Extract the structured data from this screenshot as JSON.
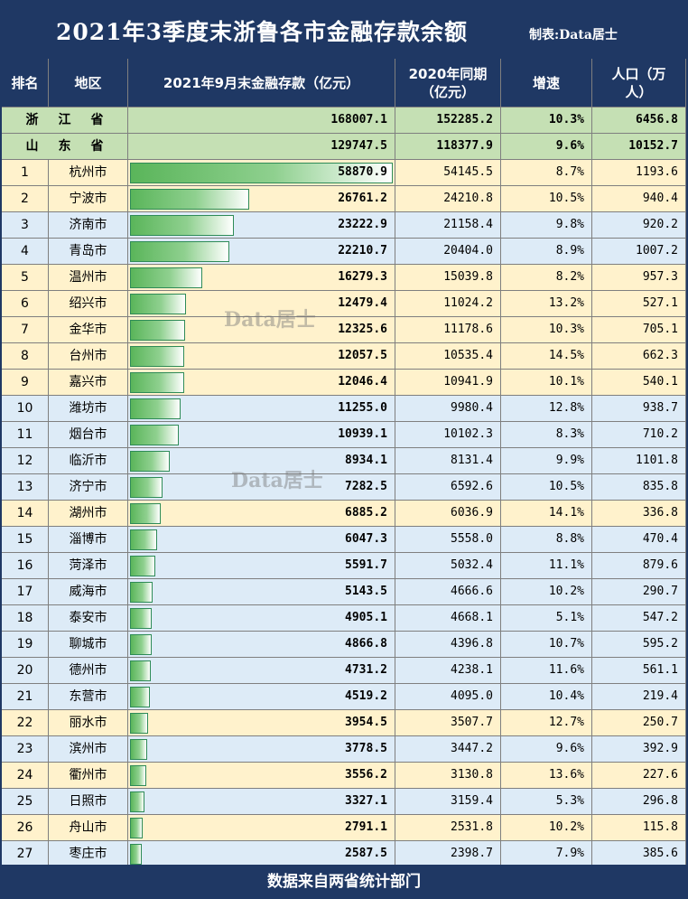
{
  "title": "2021年3季度末浙鲁各市金融存款余额",
  "credit": "制表:Data居士",
  "footer": "数据来自两省统计部门",
  "watermark": "Data居士",
  "headers": {
    "rank": "排名",
    "region": "地区",
    "deposit": "2021年9月末金融存款（亿元）",
    "prev_line1": "2020年同期",
    "prev_line2": "（亿元）",
    "growth": "增速",
    "pop_line1": "人口（万",
    "pop_line2": "人）"
  },
  "colors": {
    "header_bg": "#1f3864",
    "province_bg": "#c5e0b4",
    "zhejiang_bg": "#fff2cc",
    "shandong_bg": "#ddebf7",
    "bar": "#5ab55a"
  },
  "provinces": [
    {
      "name": "浙江省",
      "deposit": "168007.1",
      "prev": "152285.2",
      "growth": "10.3%",
      "pop": "6456.8"
    },
    {
      "name": "山东省",
      "deposit": "129747.5",
      "prev": "118377.9",
      "growth": "9.6%",
      "pop": "10152.7"
    }
  ],
  "chart_data": {
    "type": "table",
    "title": "2021年3季度末浙鲁各市金融存款余额",
    "columns": [
      "排名",
      "地区",
      "2021年9月末金融存款（亿元）",
      "2020年同期（亿元）",
      "增速",
      "人口（万人）"
    ],
    "bar_column": "2021年9月末金融存款（亿元）",
    "rows": [
      {
        "rank": "1",
        "city": "杭州市",
        "province": "zhejiang",
        "deposit": "58870.9",
        "prev": "54145.5",
        "growth": "8.7%",
        "pop": "1193.6"
      },
      {
        "rank": "2",
        "city": "宁波市",
        "province": "zhejiang",
        "deposit": "26761.2",
        "prev": "24210.8",
        "growth": "10.5%",
        "pop": "940.4"
      },
      {
        "rank": "3",
        "city": "济南市",
        "province": "shandong",
        "deposit": "23222.9",
        "prev": "21158.4",
        "growth": "9.8%",
        "pop": "920.2"
      },
      {
        "rank": "4",
        "city": "青岛市",
        "province": "shandong",
        "deposit": "22210.7",
        "prev": "20404.0",
        "growth": "8.9%",
        "pop": "1007.2"
      },
      {
        "rank": "5",
        "city": "温州市",
        "province": "zhejiang",
        "deposit": "16279.3",
        "prev": "15039.8",
        "growth": "8.2%",
        "pop": "957.3"
      },
      {
        "rank": "6",
        "city": "绍兴市",
        "province": "zhejiang",
        "deposit": "12479.4",
        "prev": "11024.2",
        "growth": "13.2%",
        "pop": "527.1"
      },
      {
        "rank": "7",
        "city": "金华市",
        "province": "zhejiang",
        "deposit": "12325.6",
        "prev": "11178.6",
        "growth": "10.3%",
        "pop": "705.1"
      },
      {
        "rank": "8",
        "city": "台州市",
        "province": "zhejiang",
        "deposit": "12057.5",
        "prev": "10535.4",
        "growth": "14.5%",
        "pop": "662.3"
      },
      {
        "rank": "9",
        "city": "嘉兴市",
        "province": "zhejiang",
        "deposit": "12046.4",
        "prev": "10941.9",
        "growth": "10.1%",
        "pop": "540.1"
      },
      {
        "rank": "10",
        "city": "潍坊市",
        "province": "shandong",
        "deposit": "11255.0",
        "prev": "9980.4",
        "growth": "12.8%",
        "pop": "938.7"
      },
      {
        "rank": "11",
        "city": "烟台市",
        "province": "shandong",
        "deposit": "10939.1",
        "prev": "10102.3",
        "growth": "8.3%",
        "pop": "710.2"
      },
      {
        "rank": "12",
        "city": "临沂市",
        "province": "shandong",
        "deposit": "8934.1",
        "prev": "8131.4",
        "growth": "9.9%",
        "pop": "1101.8"
      },
      {
        "rank": "13",
        "city": "济宁市",
        "province": "shandong",
        "deposit": "7282.5",
        "prev": "6592.6",
        "growth": "10.5%",
        "pop": "835.8"
      },
      {
        "rank": "14",
        "city": "湖州市",
        "province": "zhejiang",
        "deposit": "6885.2",
        "prev": "6036.9",
        "growth": "14.1%",
        "pop": "336.8"
      },
      {
        "rank": "15",
        "city": "淄博市",
        "province": "shandong",
        "deposit": "6047.3",
        "prev": "5558.0",
        "growth": "8.8%",
        "pop": "470.4"
      },
      {
        "rank": "16",
        "city": "菏泽市",
        "province": "shandong",
        "deposit": "5591.7",
        "prev": "5032.4",
        "growth": "11.1%",
        "pop": "879.6"
      },
      {
        "rank": "17",
        "city": "威海市",
        "province": "shandong",
        "deposit": "5143.5",
        "prev": "4666.6",
        "growth": "10.2%",
        "pop": "290.7"
      },
      {
        "rank": "18",
        "city": "泰安市",
        "province": "shandong",
        "deposit": "4905.1",
        "prev": "4668.1",
        "growth": "5.1%",
        "pop": "547.2"
      },
      {
        "rank": "19",
        "city": "聊城市",
        "province": "shandong",
        "deposit": "4866.8",
        "prev": "4396.8",
        "growth": "10.7%",
        "pop": "595.2"
      },
      {
        "rank": "20",
        "city": "德州市",
        "province": "shandong",
        "deposit": "4731.2",
        "prev": "4238.1",
        "growth": "11.6%",
        "pop": "561.1"
      },
      {
        "rank": "21",
        "city": "东营市",
        "province": "shandong",
        "deposit": "4519.2",
        "prev": "4095.0",
        "growth": "10.4%",
        "pop": "219.4"
      },
      {
        "rank": "22",
        "city": "丽水市",
        "province": "zhejiang",
        "deposit": "3954.5",
        "prev": "3507.7",
        "growth": "12.7%",
        "pop": "250.7"
      },
      {
        "rank": "23",
        "city": "滨州市",
        "province": "shandong",
        "deposit": "3778.5",
        "prev": "3447.2",
        "growth": "9.6%",
        "pop": "392.9"
      },
      {
        "rank": "24",
        "city": "衢州市",
        "province": "zhejiang",
        "deposit": "3556.2",
        "prev": "3130.8",
        "growth": "13.6%",
        "pop": "227.6"
      },
      {
        "rank": "25",
        "city": "日照市",
        "province": "shandong",
        "deposit": "3327.1",
        "prev": "3159.4",
        "growth": "5.3%",
        "pop": "296.8"
      },
      {
        "rank": "26",
        "city": "舟山市",
        "province": "zhejiang",
        "deposit": "2791.1",
        "prev": "2531.8",
        "growth": "10.2%",
        "pop": "115.8"
      },
      {
        "rank": "27",
        "city": "枣庄市",
        "province": "shandong",
        "deposit": "2587.5",
        "prev": "2398.7",
        "growth": "7.9%",
        "pop": "385.6"
      }
    ]
  }
}
